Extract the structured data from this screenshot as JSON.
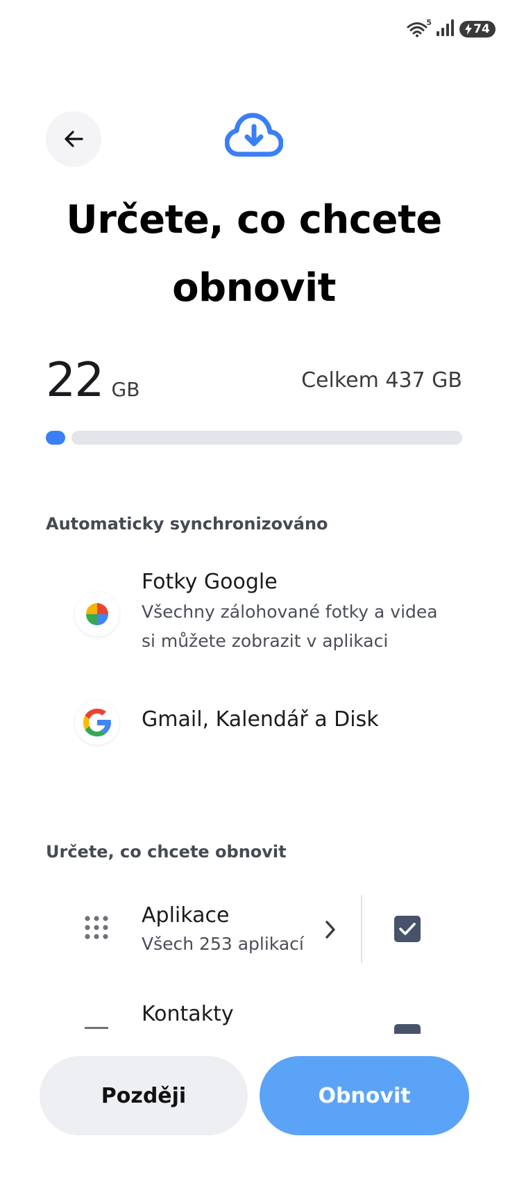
{
  "status_bar": {
    "wifi_badge": "5",
    "battery_level": "74",
    "icons": [
      "wifi-icon",
      "signal-icon",
      "battery-charging-icon"
    ]
  },
  "header": {
    "back_icon": "arrow-left-icon",
    "hero_icon": "cloud-download-icon",
    "title": "Určete, co chcete obnovit"
  },
  "storage": {
    "used_value": "22",
    "used_unit": "GB",
    "total_label": "Celkem 437 GB",
    "used_fraction": 0.05
  },
  "auto_sync": {
    "header": "Automaticky synchronizováno",
    "items": [
      {
        "icon": "google-photos-icon",
        "title": "Fotky Google",
        "subtitle": "Všechny zálohované fotky a videa si můžete zobrazit v aplikaci"
      },
      {
        "icon": "google-g-icon",
        "title": "Gmail, Kalendář a Disk"
      }
    ]
  },
  "restore": {
    "header": "Určete, co chcete obnovit",
    "items": [
      {
        "icon": "apps-grid-icon",
        "title": "Aplikace",
        "subtitle": "Všech 253 aplikací",
        "checked": true
      },
      {
        "icon": "contacts-icon",
        "title": "Kontakty",
        "checked": true
      }
    ]
  },
  "buttons": {
    "later": "Později",
    "restore": "Obnovit"
  },
  "colors": {
    "accent": "#3a7ff5",
    "primary_button": "#5ba3f7",
    "checkbox": "#47536a",
    "secondary_button": "#eeeff2"
  }
}
